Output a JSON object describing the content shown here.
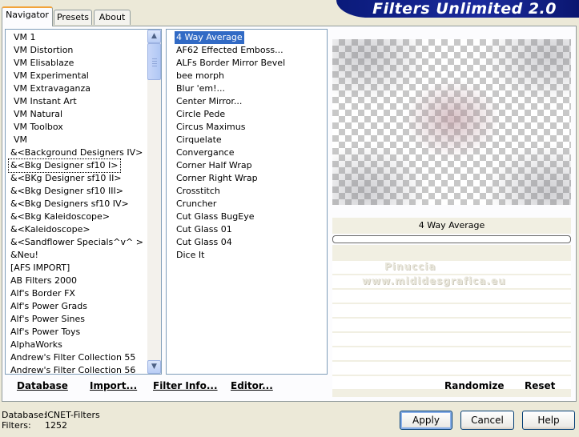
{
  "tabs": [
    "Navigator",
    "Presets",
    "About"
  ],
  "title": "Filters Unlimited 2.0",
  "categories": [
    "VM 1",
    "VM Distortion",
    "VM Elisablaze",
    "VM Experimental",
    "VM Extravaganza",
    "VM Instant Art",
    "VM Natural",
    "VM Toolbox",
    "VM",
    "&<Background Designers IV>",
    "&<Bkg Designer sf10 I>",
    "&<BKg Designer sf10 II>",
    "&<Bkg Designer sf10 III>",
    "&<Bkg Designers sf10 IV>",
    "&<Bkg Kaleidoscope>",
    "&<Kaleidoscope>",
    "&<Sandflower Specials^v^ >",
    "&Neu!",
    "[AFS IMPORT]",
    "AB Filters 2000",
    "Alf's Border FX",
    "Alf's Power Grads",
    "Alf's Power Sines",
    "Alf's Power Toys",
    "AlphaWorks",
    "Andrew's Filter Collection 55",
    "Andrew's Filter Collection 56"
  ],
  "selected_category_index": 10,
  "filters": [
    "4 Way Average",
    "AF62 Effected Emboss...",
    "ALFs Border Mirror Bevel",
    "bee morph",
    "Blur 'em!...",
    "Center Mirror...",
    "Circle Pede",
    "Circus Maximus",
    "Cirquelate",
    "Convergance",
    "Corner Half Wrap",
    "Corner Right Wrap",
    "Crosstitch",
    "Cruncher",
    "Cut Glass  BugEye",
    "Cut Glass 01",
    "Cut Glass 04",
    "Dice It"
  ],
  "selected_filter_index": 0,
  "filter_name": "4 Way Average",
  "watermark": {
    "line1": "Pinuccia",
    "line2": "www.mididesgrafica.eu"
  },
  "links": {
    "database": "Database",
    "import": "Import...",
    "filter_info": "Filter Info...",
    "editor": "Editor...",
    "randomize": "Randomize",
    "reset": "Reset"
  },
  "status": {
    "database_label": "Database:",
    "database_value": "ICNET-Filters",
    "filters_label": "Filters:",
    "filters_value": "1252"
  },
  "buttons": {
    "apply": "Apply",
    "cancel": "Cancel",
    "help": "Help"
  },
  "colors": {
    "banner": "#0a1a7a",
    "selection": "#316ac5",
    "tab_highlight": "#f2a33a"
  }
}
